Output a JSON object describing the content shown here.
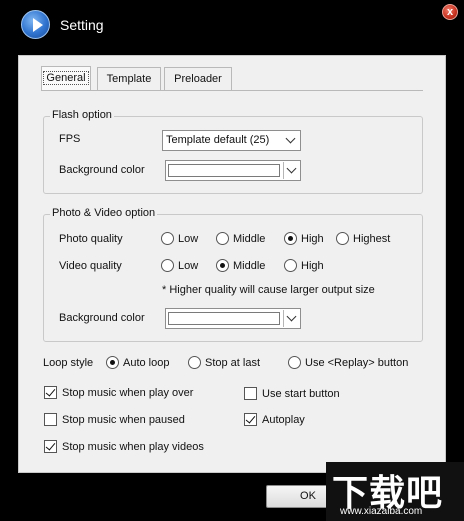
{
  "window": {
    "title": "Setting",
    "close_glyph": "x"
  },
  "tabs": [
    {
      "label": "General",
      "active": true
    },
    {
      "label": "Template",
      "active": false
    },
    {
      "label": "Preloader",
      "active": false
    }
  ],
  "flash": {
    "legend": "Flash option",
    "fps_label": "FPS",
    "fps_value": "Template default (25)",
    "bg_label": "Background color"
  },
  "photo_video": {
    "legend": "Photo & Video option",
    "photo_label": "Photo quality",
    "photo_options": [
      "Low",
      "Middle",
      "High",
      "Highest"
    ],
    "photo_selected": "High",
    "video_label": "Video quality",
    "video_options": [
      "Low",
      "Middle",
      "High"
    ],
    "video_selected": "Middle",
    "note": "* Higher quality will cause larger output size",
    "bg_label": "Background color"
  },
  "loop": {
    "label": "Loop style",
    "options": [
      "Auto loop",
      "Stop at last",
      "Use <Replay> button"
    ],
    "selected": "Auto loop"
  },
  "checkboxes": {
    "stop_music_play_over": {
      "label": "Stop music when play over",
      "checked": true
    },
    "use_start_button": {
      "label": "Use start button",
      "checked": false
    },
    "stop_music_paused": {
      "label": "Stop music when paused",
      "checked": false
    },
    "autoplay": {
      "label": "Autoplay",
      "checked": true
    },
    "stop_music_videos": {
      "label": "Stop music when play videos",
      "checked": true
    }
  },
  "ok_label": "OK",
  "watermark": {
    "main": "下载吧",
    "sub": "www.xiazaiba.com"
  },
  "colors": {
    "panel_bg": "#f0f0f0",
    "title_bg": "#000000",
    "close_red": "#c7321f"
  }
}
